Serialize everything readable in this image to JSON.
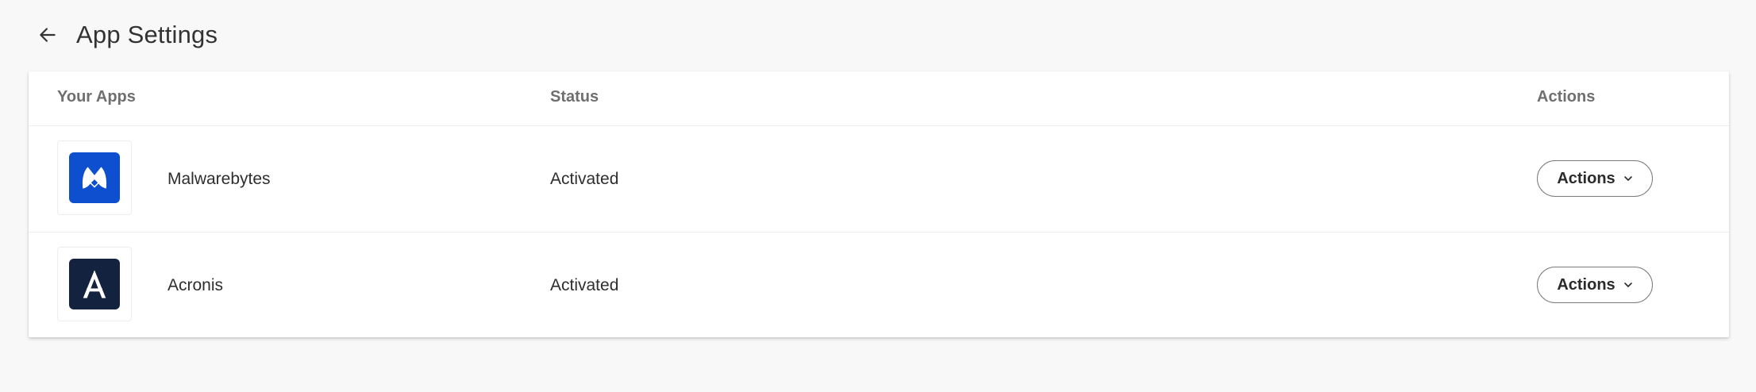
{
  "header": {
    "title": "App Settings",
    "back_icon": "arrow-left-icon"
  },
  "table": {
    "columns": {
      "apps": "Your Apps",
      "status": "Status",
      "actions": "Actions"
    },
    "rows": [
      {
        "name": "Malwarebytes",
        "status": "Activated",
        "action_label": "Actions",
        "logo_icon": "malwarebytes-logo-icon",
        "logo_color": "#0d4fce"
      },
      {
        "name": "Acronis",
        "status": "Activated",
        "action_label": "Actions",
        "logo_icon": "acronis-logo-icon",
        "logo_color": "#13223f"
      }
    ]
  },
  "colors": {
    "background": "#f8f8f8",
    "card": "#ffffff",
    "header_text": "#6f6f6f"
  }
}
